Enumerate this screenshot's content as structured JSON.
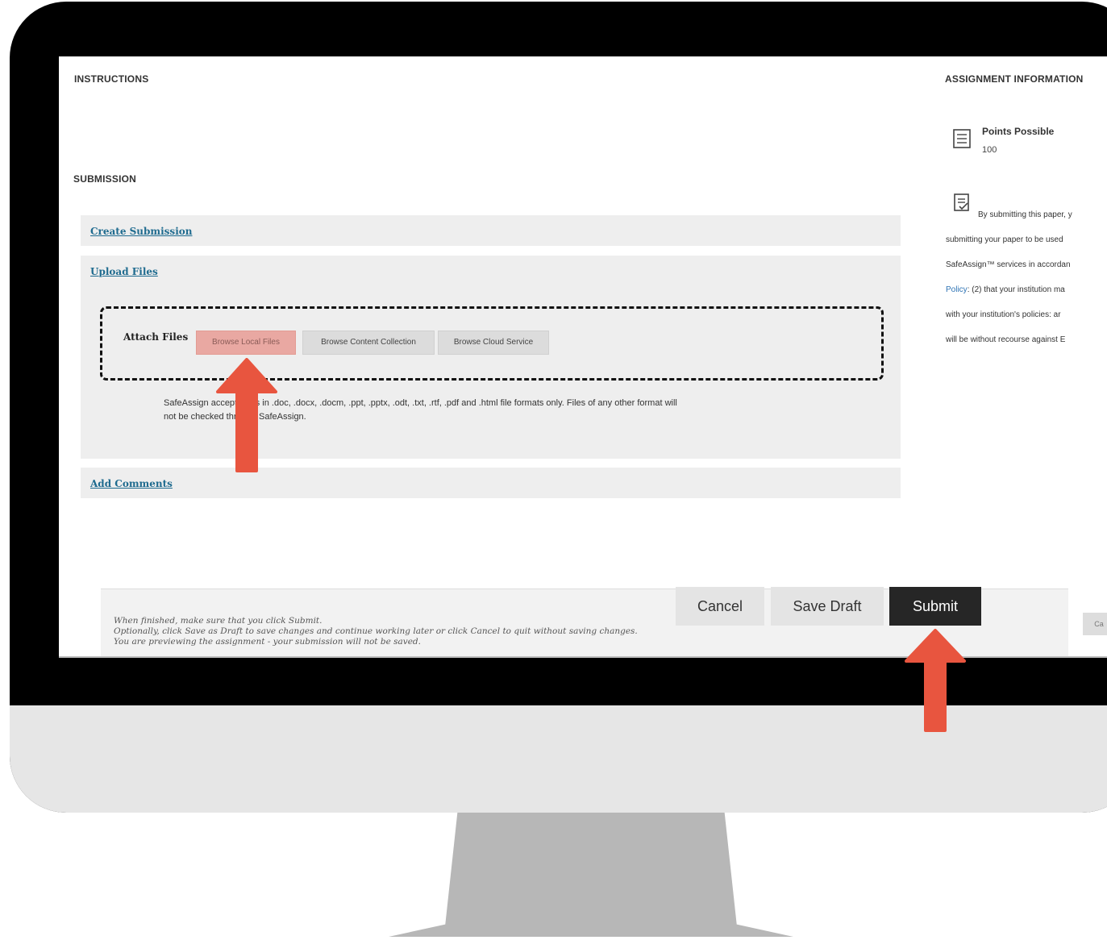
{
  "instructions_heading": "INSTRUCTIONS",
  "submission_heading": "SUBMISSION",
  "assignment_info_heading": "ASSIGNMENT INFORMATION",
  "points": {
    "title": "Points Possible",
    "value": "100"
  },
  "policy": {
    "line1": "By submitting this paper, y",
    "line2": "submitting your paper to be used",
    "line3": "SafeAssign™ services in accordan",
    "line4_link": "Policy",
    "line4_rest": ": (2) that your institution ma",
    "line5": "with your institution's policies: ar",
    "line6": "will be without recourse against E"
  },
  "panels": {
    "create_submission": "Create Submission",
    "upload_files": "Upload Files",
    "add_comments": "Add Comments"
  },
  "attach": {
    "label": "Attach Files",
    "browse_local": "Browse Local Files",
    "browse_content": "Browse Content Collection",
    "browse_cloud": "Browse Cloud Service"
  },
  "safeassign_note": {
    "line1": "SafeAssign accepts files in .doc, .docx, .docm, .ppt, .pptx, .odt, .txt, .rtf, .pdf and .html file formats only. Files of any other format will",
    "line2": "not be checked through SafeAssign."
  },
  "footer": {
    "line1": "When finished, make sure that you click Submit.",
    "line2": "Optionally, click Save as Draft to save changes and continue working later or click Cancel to quit without saving changes.",
    "line3": "You are previewing the assignment - your submission will not be saved."
  },
  "actions": {
    "cancel": "Cancel",
    "save_draft": "Save Draft",
    "submit": "Submit",
    "cut_button": "Ca"
  },
  "colors": {
    "arrow": "#e8553f",
    "highlight": "#e9a8a2",
    "link": "#1f6b8f"
  }
}
